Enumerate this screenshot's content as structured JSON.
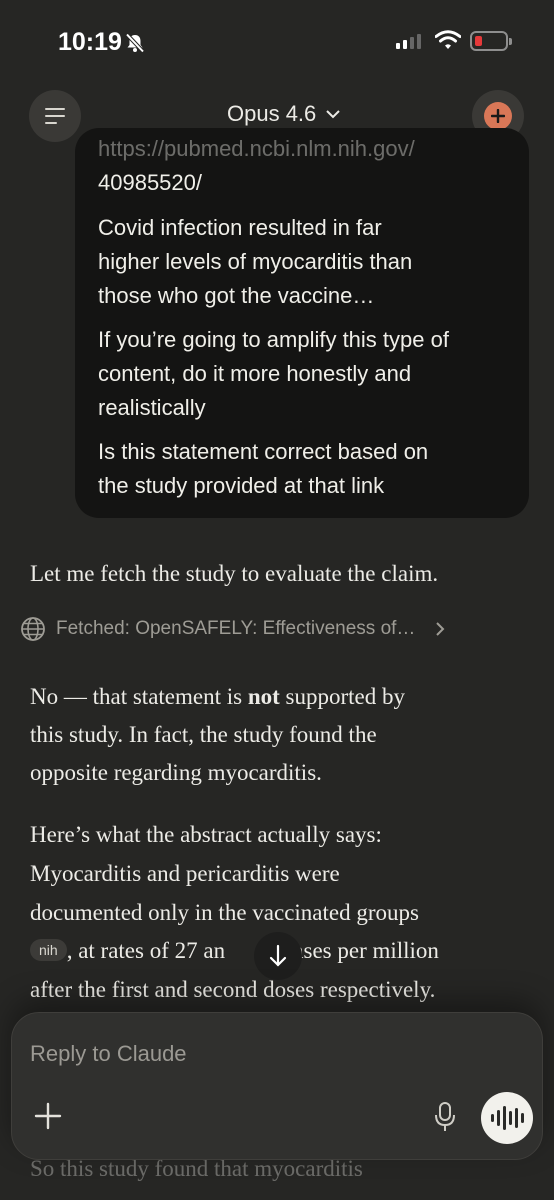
{
  "status_bar": {
    "time": "10:19",
    "icons": [
      "bell-slash-icon",
      "cellular-signal-icon",
      "wifi-icon",
      "battery-low-icon"
    ],
    "battery_color": "#e5393a"
  },
  "header": {
    "model_name": "Opus 4.6",
    "menu_icon": "hamburger-menu-icon",
    "new_chat_icon": "new-chat-plus-icon",
    "accent_color": "#d97757"
  },
  "user_message": {
    "url_line1": "https://pubmed.ncbi.nlm.nih.gov/",
    "url_line2": "40985520/",
    "para1": [
      "Covid infection resulted in far",
      "higher levels of myocarditis than",
      "those who got the vaccine…"
    ],
    "para2": [
      "If you’re going to amplify this type of",
      "content, do it more honestly and",
      "realistically"
    ],
    "para3": [
      "Is this statement correct based on",
      "the study provided at that link"
    ]
  },
  "assistant": {
    "intro": "Let me fetch the study to evaluate the claim.",
    "fetched_label": "Fetched: OpenSAFELY: Effectiveness of…",
    "answer_line1_pre": "No — that statement is ",
    "answer_line1_bold": "not",
    "answer_line1_post": " supported by",
    "answer_line2": "this study. In fact, the study found the",
    "answer_line3": "opposite regarding myocarditis.",
    "quote_line1": "Here’s what the abstract actually says:",
    "quote_line2": "Myocarditis and pericarditis were",
    "quote_line3": "documented only in the vaccinated groups",
    "citation": "nih",
    "quote_line4_a": ", at rates of 27 an",
    "quote_line4_b": "cases per million",
    "quote_line5": "after the first and second doses respectively.",
    "faded_line": "So this study found that myocarditis"
  },
  "composer": {
    "placeholder": "Reply to Claude",
    "icons": [
      "plus-icon",
      "microphone-icon",
      "voice-mode-icon"
    ]
  }
}
